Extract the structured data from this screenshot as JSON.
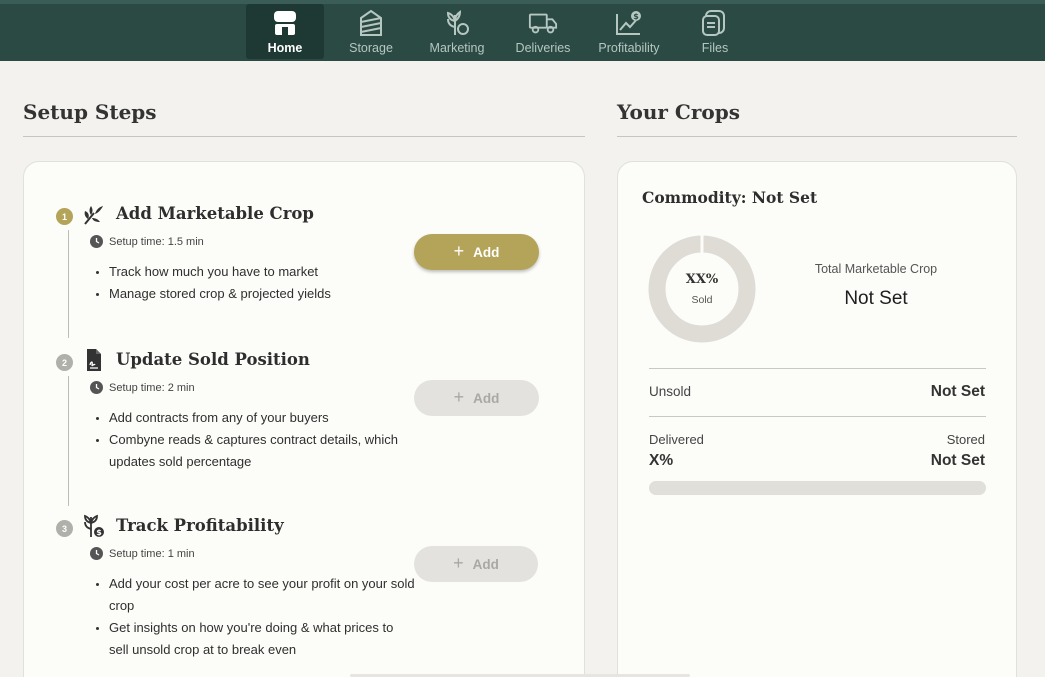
{
  "nav": {
    "items": [
      {
        "label": "Home",
        "icon": "home-icon"
      },
      {
        "label": "Storage",
        "icon": "storage-bin-icon"
      },
      {
        "label": "Marketing",
        "icon": "marketing-wheat-icon"
      },
      {
        "label": "Deliveries",
        "icon": "delivery-truck-icon"
      },
      {
        "label": "Profitability",
        "icon": "profitability-chart-icon"
      },
      {
        "label": "Files",
        "icon": "files-icon"
      }
    ],
    "active": "Home"
  },
  "setup": {
    "title": "Setup Steps",
    "steps": [
      {
        "number": "1",
        "title": "Add Marketable Crop",
        "icon": "wheat-leaf-icon",
        "time": "Setup time: 1.5 min",
        "bullets": [
          "Track how much you have to market",
          "Manage stored crop & projected yields"
        ],
        "button": "Add",
        "enabled": true
      },
      {
        "number": "2",
        "title": "Update Sold Position",
        "icon": "contract-document-icon",
        "time": "Setup time: 2 min",
        "bullets": [
          "Add contracts from any of your buyers",
          "Combyne reads & captures contract details, which updates sold percentage"
        ],
        "button": "Add",
        "enabled": false
      },
      {
        "number": "3",
        "title": "Track Profitability",
        "icon": "wheat-dollar-icon",
        "time": "Setup time: 1 min",
        "bullets": [
          "Add your cost per acre to see your profit on your sold crop",
          "Get insights on how you're doing & what prices to sell unsold crop at to break even"
        ],
        "button": "Add",
        "enabled": false
      }
    ]
  },
  "crops": {
    "title": "Your Crops",
    "commodity": "Commodity: Not Set",
    "donut_value": "XX%",
    "donut_label": "Sold",
    "total_label": "Total Marketable Crop",
    "total_value": "Not Set",
    "unsold_label": "Unsold",
    "unsold_value": "Not Set",
    "delivered_label": "Delivered",
    "delivered_value": "X%",
    "stored_label": "Stored",
    "stored_value": "Not Set",
    "delivered_fraction": 0
  },
  "colors": {
    "nav_bg": "#2b4a44",
    "accent_gold": "#b3a45a",
    "disabled_btn": "#e3e2de",
    "donut_track": "#dedcd5"
  }
}
